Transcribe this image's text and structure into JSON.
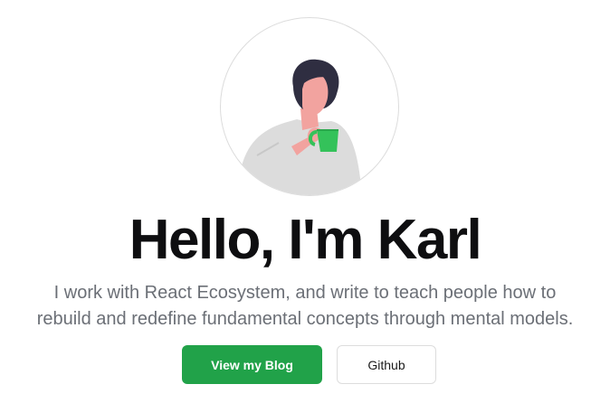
{
  "hero": {
    "avatar_icon": "person-drinking-coffee-illustration",
    "title": "Hello, I'm Karl",
    "tagline_line1": "I work with React Ecosystem, and write to teach people how to",
    "tagline_line2": "rebuild and redefine fundamental concepts through mental models.",
    "primary_button": "View my Blog",
    "secondary_button": "Github"
  },
  "colors": {
    "primary": "#21a249",
    "title": "#0e0e10",
    "tagline": "#6b6f76",
    "hair": "#2f2e41",
    "skin": "#f2a39f",
    "shirt": "#e0e0e0",
    "mug": "#34c25a"
  }
}
